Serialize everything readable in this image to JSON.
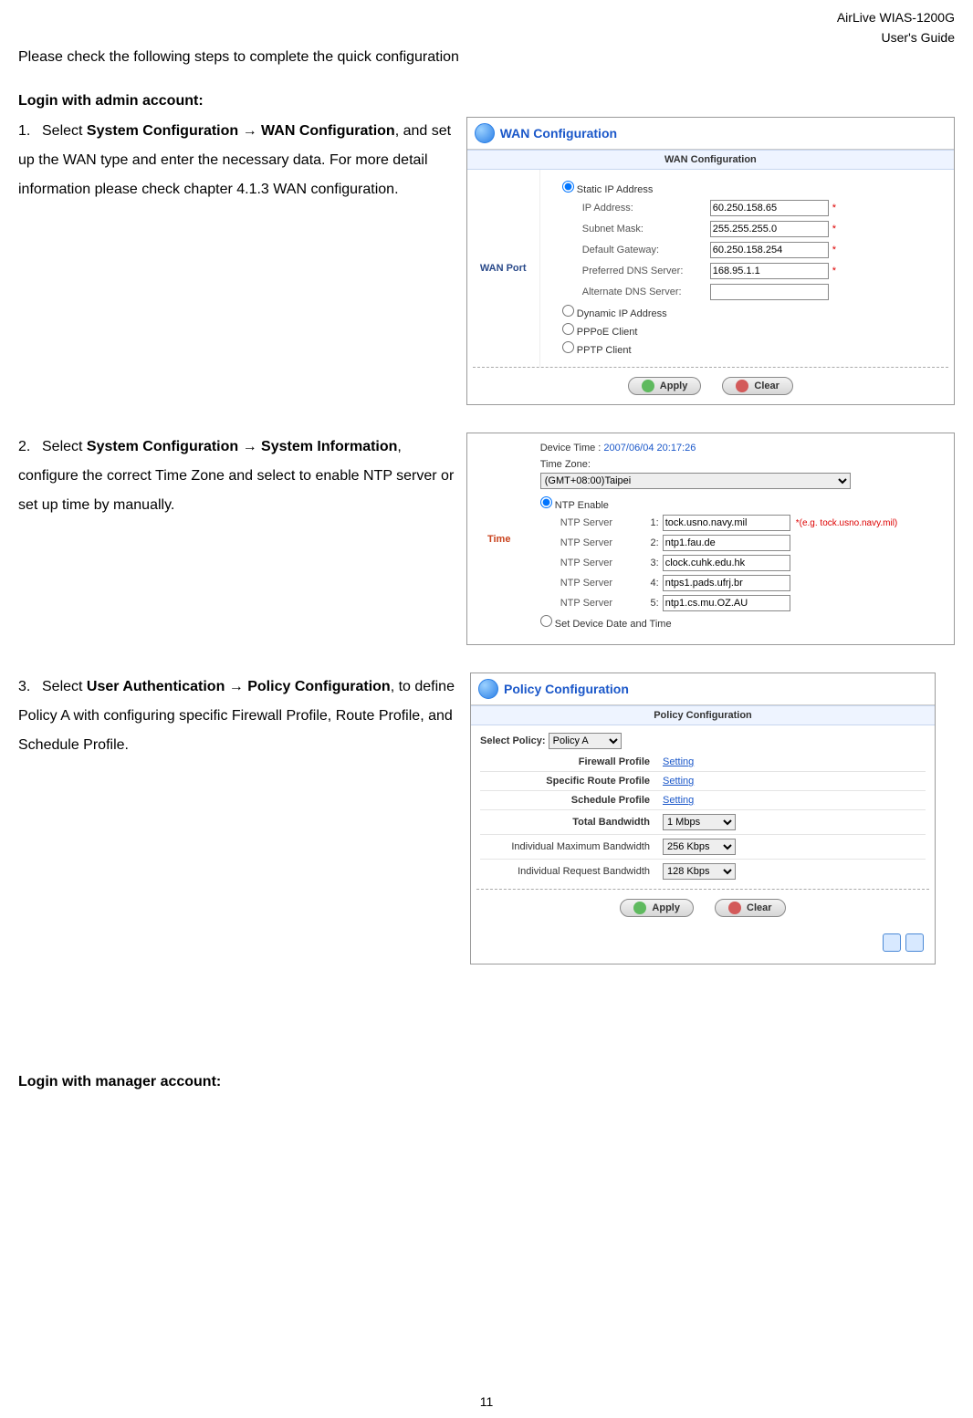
{
  "header": {
    "line1": "AirLive WIAS-1200G",
    "line2": "User's Guide"
  },
  "intro": "Please check the following steps to complete the quick configuration",
  "login_admin_heading": "Login with admin account:",
  "login_manager_heading": "Login with manager account:",
  "page_number": "11",
  "steps": {
    "s1": {
      "num": "1.",
      "pre": "Select ",
      "bold": "System Configuration → WAN Configuration",
      "post": ", and set up the WAN type and enter the necessary data. For more detail information please check chapter 4.1.3 WAN configuration."
    },
    "s2": {
      "num": "2.",
      "pre": "Select ",
      "bold": "System Configuration → System Information",
      "post": ", configure the correct Time Zone and select to enable NTP server or set up time by manually."
    },
    "s3": {
      "num": "3.",
      "pre": "Select ",
      "bold": "User Authentication → Policy Configuration",
      "post": ", to define Policy A with configuring specific Firewall Profile, Route Profile, and Schedule Profile."
    }
  },
  "shot1": {
    "title": "WAN Configuration",
    "panel_head": "WAN Configuration",
    "left_label": "WAN Port",
    "opt_static": "Static IP Address",
    "opt_dynamic": "Dynamic IP Address",
    "opt_pppoe": "PPPoE Client",
    "opt_pptp": "PPTP Client",
    "f_ip_label": "IP Address:",
    "f_ip_value": "60.250.158.65",
    "f_mask_label": "Subnet Mask:",
    "f_mask_value": "255.255.255.0",
    "f_gw_label": "Default Gateway:",
    "f_gw_value": "60.250.158.254",
    "f_pdns_label": "Preferred DNS Server:",
    "f_pdns_value": "168.95.1.1",
    "f_adns_label": "Alternate DNS Server:",
    "f_adns_value": "",
    "btn_apply": "Apply",
    "btn_clear": "Clear",
    "star": "*"
  },
  "shot2": {
    "left_label": "Time",
    "device_time_label": "Device Time : ",
    "device_time_value": "2007/06/04 20:17:26",
    "tz_label": "Time Zone:",
    "tz_value": "(GMT+08:00)Taipei",
    "ntp_enable": "NTP Enable",
    "ntp_server_label": "NTP Server",
    "ntp1_idx": "1:",
    "ntp1_val": "tock.usno.navy.mil",
    "ntp_note": "*(e.g. tock.usno.navy.mil)",
    "ntp2_idx": "2:",
    "ntp2_val": "ntp1.fau.de",
    "ntp3_idx": "3:",
    "ntp3_val": "clock.cuhk.edu.hk",
    "ntp4_idx": "4:",
    "ntp4_val": "ntps1.pads.ufrj.br",
    "ntp5_idx": "5:",
    "ntp5_val": "ntp1.cs.mu.OZ.AU",
    "set_manual": "Set Device Date and Time"
  },
  "shot3": {
    "title": "Policy Configuration",
    "panel_head": "Policy Configuration",
    "select_policy_label": "Select Policy:",
    "select_policy_value": "Policy A",
    "row_fw_label": "Firewall Profile",
    "row_fw_link": "Setting",
    "row_route_label": "Specific Route Profile",
    "row_route_link": "Setting",
    "row_sched_label": "Schedule Profile",
    "row_sched_link": "Setting",
    "row_total_label": "Total Bandwidth",
    "row_total_value": "1 Mbps",
    "row_indmax_label": "Individual Maximum Bandwidth",
    "row_indmax_value": "256 Kbps",
    "row_indreq_label": "Individual Request Bandwidth",
    "row_indreq_value": "128 Kbps",
    "btn_apply": "Apply",
    "btn_clear": "Clear"
  }
}
